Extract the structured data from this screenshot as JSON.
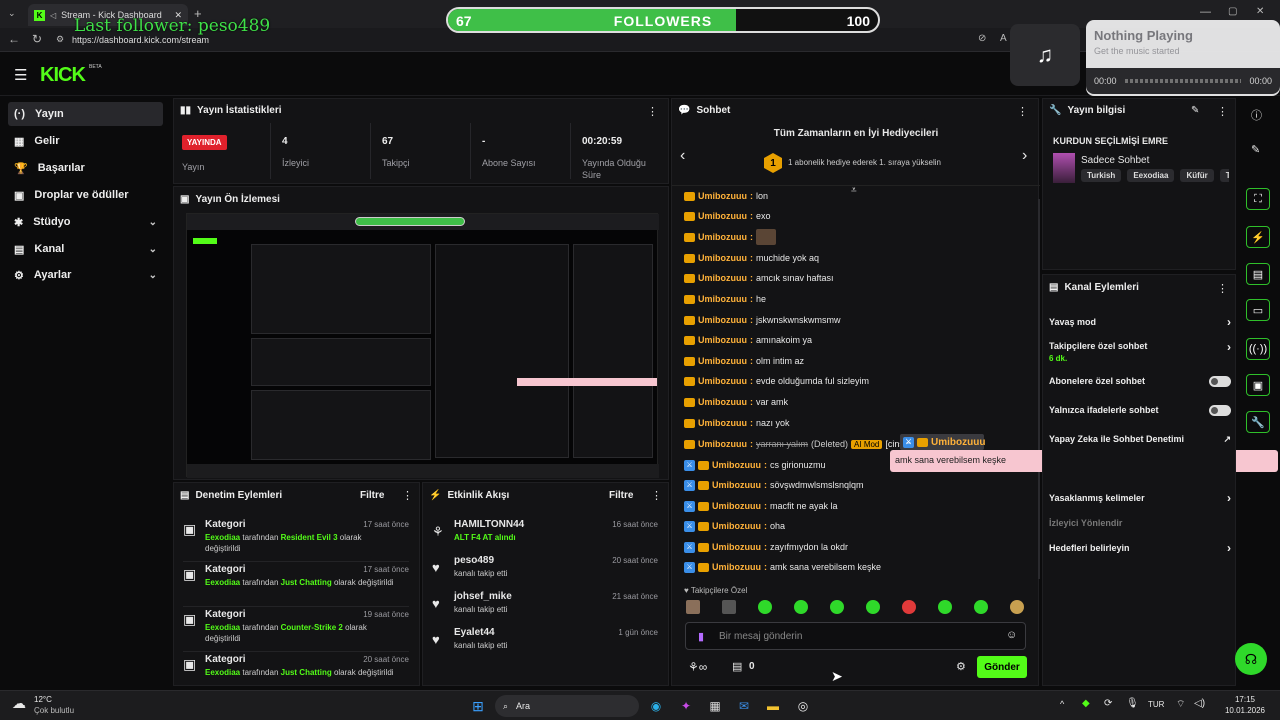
{
  "browser": {
    "tab_title": "Stream - Kick Dashboard",
    "url": "https://dashboard.kick.com/stream"
  },
  "overlay": {
    "last_follower": "Last follower: peso489",
    "followers_current": "67",
    "followers_label": "FOLLOWERS",
    "followers_goal": "100",
    "followers_progress": 0.67,
    "music_title": "Nothing Playing",
    "music_sub": "Get the music started",
    "music_time_start": "00:00",
    "music_time_end": "00:00"
  },
  "header": {
    "logo": "KICK",
    "beta": "BETA"
  },
  "sidebar": {
    "items": [
      {
        "label": "Yayın",
        "icon": "(·)"
      },
      {
        "label": "Gelir",
        "icon": "▦"
      },
      {
        "label": "Başarılar",
        "icon": "🏆"
      },
      {
        "label": "Droplar ve ödüller",
        "icon": "▣"
      },
      {
        "label": "Stüdyo",
        "icon": "✱"
      },
      {
        "label": "Kanal",
        "icon": "▤"
      },
      {
        "label": "Ayarlar",
        "icon": "⚙"
      }
    ]
  },
  "stats": {
    "title": "Yayın İstatistikleri",
    "live_badge": "YAYINDA",
    "live_label": "Yayın",
    "viewers_value": "4",
    "viewers_label": "İzleyici",
    "followers_value": "67",
    "followers_label": "Takipçi",
    "subs_value": "-",
    "subs_label": "Abone Sayısı",
    "duration_value": "00:20:59",
    "duration_label": "Yayında Olduğu Süre"
  },
  "preview": {
    "title": "Yayın Ön İzlemesi"
  },
  "moderation": {
    "title": "Denetim Eylemleri",
    "filter": "Filtre",
    "items": [
      {
        "head": "Kategori",
        "time": "17 saat önce",
        "user": "Eexodiaa",
        "mid": " tarafından ",
        "target": "Resident Evil 3",
        "tail": " olarak değiştirildi"
      },
      {
        "head": "Kategori",
        "time": "17 saat önce",
        "user": "Eexodiaa",
        "mid": " tarafından ",
        "target": "Just Chatting",
        "tail": " olarak değiştirildi"
      },
      {
        "head": "Kategori",
        "time": "19 saat önce",
        "user": "Eexodiaa",
        "mid": " tarafından ",
        "target": "Counter-Strike 2",
        "tail": " olarak değiştirildi"
      },
      {
        "head": "Kategori",
        "time": "20 saat önce",
        "user": "Eexodiaa",
        "mid": " tarafından ",
        "target": "Just Chatting",
        "tail": " olarak değiştirildi"
      }
    ]
  },
  "activity": {
    "title": "Etkinlik Akışı",
    "filter": "Filtre",
    "items": [
      {
        "name": "HAMILTONN44",
        "time": "16 saat önce",
        "detail": "ALT F4 AT alındı",
        "icon": "gift"
      },
      {
        "name": "peso489",
        "time": "20 saat önce",
        "detail": "kanalı takip etti",
        "icon": "heart"
      },
      {
        "name": "johsef_mike",
        "time": "21 saat önce",
        "detail": "kanalı takip etti",
        "icon": "heart"
      },
      {
        "name": "Eyalet44",
        "time": "1 gün önce",
        "detail": "kanalı takip etti",
        "icon": "heart"
      }
    ]
  },
  "chat": {
    "title": "Sohbet",
    "gifters_title": "Tüm Zamanların en İyi Hediyecileri",
    "gifters_rank": "1",
    "gifters_text": "1 abonelik hediye ederek 1. sıraya yükselin",
    "messages": [
      {
        "user": "Umibozuuu",
        "text": "lon",
        "mod": false
      },
      {
        "user": "Umibozuuu",
        "text": "exo",
        "mod": false
      },
      {
        "user": "Umibozuuu",
        "text": "",
        "mod": false
      },
      {
        "user": "Umibozuuu",
        "text": "muchide yok aq",
        "mod": false
      },
      {
        "user": "Umibozuuu",
        "text": "amcık sınav haftası",
        "mod": false
      },
      {
        "user": "Umibozuuu",
        "text": "he",
        "mod": false
      },
      {
        "user": "Umibozuuu",
        "text": "jskwnskwnskwmsmw",
        "mod": false
      },
      {
        "user": "Umibozuuu",
        "text": "amınakoim ya",
        "mod": false
      },
      {
        "user": "Umibozuuu",
        "text": "olm intim az",
        "mod": false
      },
      {
        "user": "Umibozuuu",
        "text": "evde olduğumda ful sizleyim",
        "mod": false
      },
      {
        "user": "Umibozuuu",
        "text": "var amk",
        "mod": false
      },
      {
        "user": "Umibozuuu",
        "text": "nazı yok",
        "mod": false
      },
      {
        "user": "Umibozuuu",
        "text": "cs girionuzmu",
        "mod": true
      },
      {
        "user": "Umibozuuu",
        "text": "sövşwdmwlsmslsnqlqm",
        "mod": true
      },
      {
        "user": "Umibozuuu",
        "text": "macfit ne ayak la",
        "mod": true
      },
      {
        "user": "Umibozuuu",
        "text": "oha",
        "mod": true
      },
      {
        "user": "Umibozuuu",
        "text": "zayıfmıydon la okdr",
        "mod": true
      },
      {
        "user": "Umibozuuu",
        "text": "amk sana verebilsem keşke",
        "mod": true
      }
    ],
    "deleted": {
      "user": "Umibozuuu",
      "text": "yarranı yalım",
      "flag": "(Deleted)",
      "aimod": "AI Mod",
      "cat": "[cinsel"
    },
    "popup_user": "Umibozuuu",
    "popup_text": "amk sana verebilsem keşke",
    "emote_label": "Takipçilere Özel",
    "input_placeholder": "Bir mesaj gönderin",
    "points": "0",
    "send": "Gönder"
  },
  "stream_info": {
    "title": "Yayın bilgisi",
    "stream_title": "KURDUN SEÇİLMİŞİ EMRE",
    "category": "Sadece Sohbet",
    "tags": [
      "Turkish",
      "Eexodiaa",
      "Küfür",
      "T"
    ]
  },
  "channel_actions": {
    "title": "Kanal Eylemleri",
    "slow_mode": "Yavaş mod",
    "followers_only": "Takipçilere özel sohbet",
    "followers_only_value": "6 dk.",
    "subs_only": "Abonelere özel sohbet",
    "emote_only": "Yalnızca ifadelerle sohbet",
    "ai_mod": "Yapay Zeka ile Sohbet Denetimi",
    "banned_words": "Yasaklanmış kelimeler",
    "viewer_guide": "İzleyici Yönlendir",
    "set_goals": "Hedefleri belirleyin"
  },
  "taskbar": {
    "weather_temp": "12°C",
    "weather_desc": "Çok bulutlu",
    "search": "Ara",
    "lang": "TUR",
    "time": "17:15",
    "date": "10.01.2026"
  },
  "colors": {
    "accent": "#53fc18",
    "live": "#e0212c",
    "username": "#ffb23a",
    "popup": "#f7c6d0"
  }
}
